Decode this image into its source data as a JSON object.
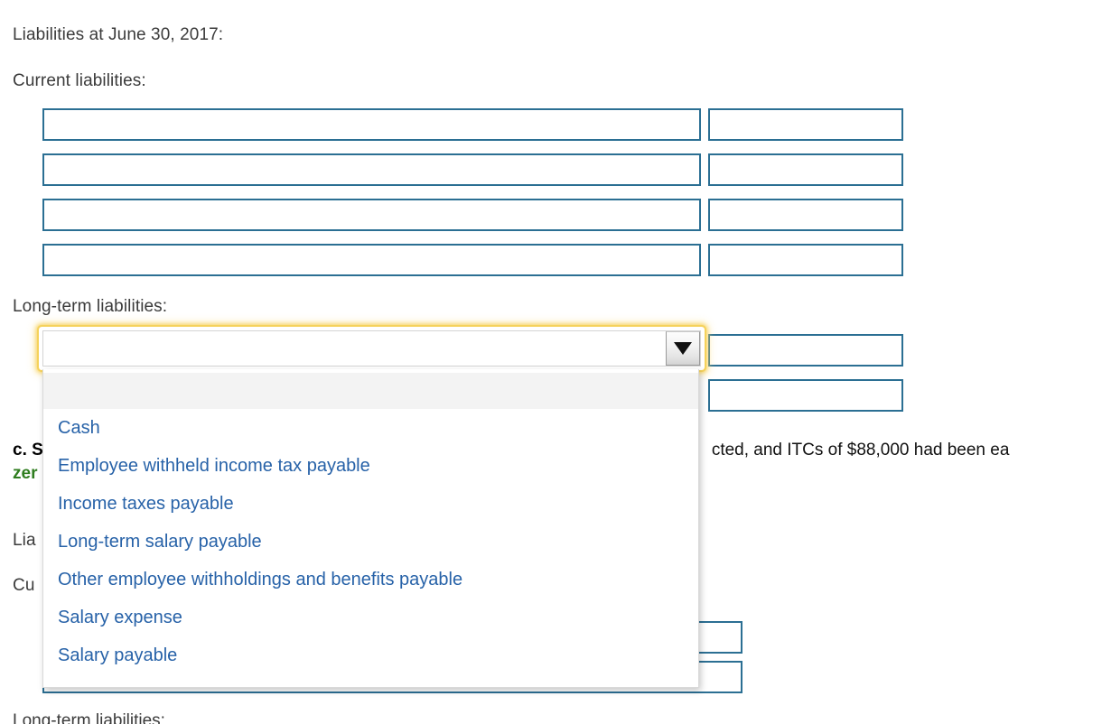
{
  "page": {
    "background": "#ffffff",
    "text_color": "#3b3b3b",
    "field_border_color": "#2b6f93",
    "option_color": "#2762a8",
    "focus_ring_color": "#f5d25c",
    "green_answer_color": "#2f7d1f"
  },
  "top_section": {
    "heading": "Liabilities at June 30, 2017:",
    "current_label": "Current liabilities:",
    "longterm_label": "Long-term liabilities:",
    "current_rows": [
      {
        "account": "",
        "amount": ""
      },
      {
        "account": "",
        "amount": ""
      },
      {
        "account": "",
        "amount": ""
      },
      {
        "account": "",
        "amount": ""
      }
    ],
    "longterm_rows": [
      {
        "account": "",
        "amount": ""
      },
      {
        "account": "",
        "amount": ""
      }
    ]
  },
  "select": {
    "value": "",
    "placeholder": "",
    "arrow_glyph": "▼",
    "expanded": true,
    "options": [
      {
        "label": "",
        "blank": true
      },
      {
        "label": "Cash",
        "blank": false
      },
      {
        "label": "Employee withheld income tax payable",
        "blank": false
      },
      {
        "label": "Income taxes payable",
        "blank": false
      },
      {
        "label": "Long-term salary payable",
        "blank": false
      },
      {
        "label": "Other employee withholdings and benefits payable",
        "blank": false
      },
      {
        "label": "Salary expense",
        "blank": false
      },
      {
        "label": "Salary payable",
        "blank": false
      }
    ]
  },
  "question_c": {
    "marker": "c.",
    "text_before_green": "S",
    "green_text": "zer",
    "text_after": "cted, and ITCs of $88,000 had been ea",
    "full_visible": "c. S                                                                                                                cted, and ITCs of $88,000 had been ea"
  },
  "bottom_section": {
    "heading": "Lia",
    "current_label": "Cu",
    "longterm_label": "Long-term liabilities:",
    "rows": [
      {
        "account": "",
        "amount": ""
      },
      {
        "account": "",
        "amount": ""
      }
    ]
  }
}
